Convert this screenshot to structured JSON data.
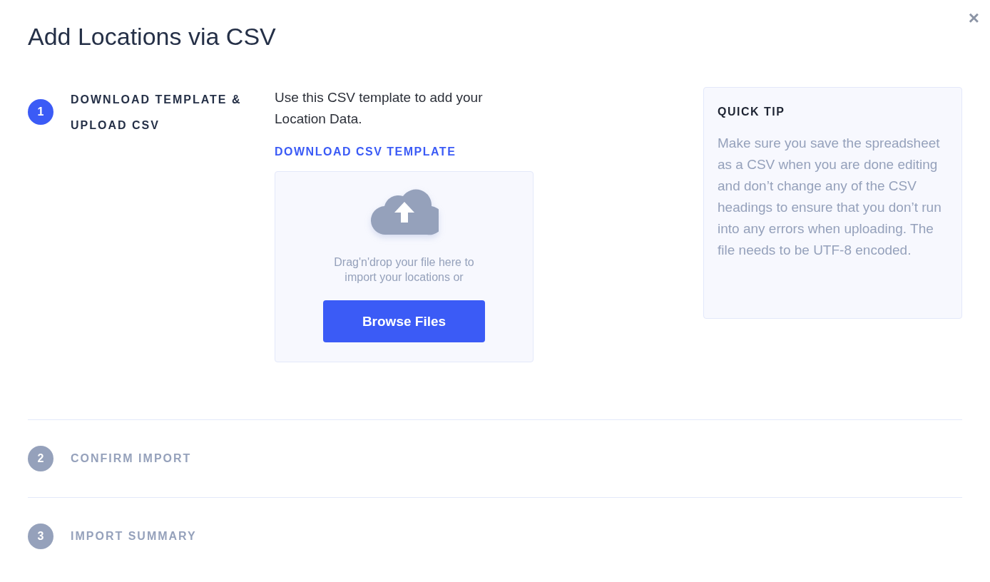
{
  "dialog": {
    "title": "Add Locations via CSV",
    "close": "×"
  },
  "steps": [
    {
      "number": "1",
      "title": "DOWNLOAD TEMPLATE & UPLOAD CSV",
      "active": true
    },
    {
      "number": "2",
      "title": "CONFIRM IMPORT",
      "active": false
    },
    {
      "number": "3",
      "title": "IMPORT SUMMARY",
      "active": false
    }
  ],
  "upload": {
    "intro": "Use this CSV template to add your Location Data.",
    "template_link": "DOWNLOAD CSV TEMPLATE",
    "drop_text": "Drag'n'drop your file here to import your locations or",
    "button": "Browse Files"
  },
  "tip": {
    "heading": "QUICK TIP",
    "text": "Make sure you save the spreadsheet as a CSV when you are done editing and don’t change any of the CSV headings to ensure that you don’t run into any errors when uploading. The file needs to be UTF-8 encoded."
  }
}
